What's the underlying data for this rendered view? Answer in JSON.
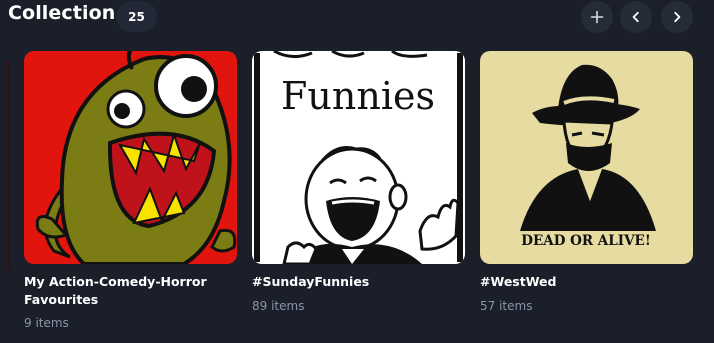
{
  "header": {
    "title": "Collection",
    "count": "25",
    "add_icon": "plus-icon",
    "prev_icon": "chevron-left-icon",
    "next_icon": "chevron-right-icon"
  },
  "collections": [
    {
      "name": "My Action-Comedy-Horror Favourites",
      "count": "9 items",
      "image": "green-cartoon-monster-on-red-background",
      "colors": {
        "background": "#e2140e",
        "monster": "#7b7c13"
      }
    },
    {
      "name": "#SundayFunnies",
      "count": "89 items",
      "image": "laughing-cartoon-man-black-and-white",
      "image_text": "Funnies",
      "colors": {
        "background": "#ffffff"
      }
    },
    {
      "name": "#WestWed",
      "count": "57 items",
      "image": "masked-cowboy-wanted-poster",
      "image_text": "DEAD OR ALIVE!",
      "colors": {
        "background": "#e6dba0"
      }
    }
  ],
  "colors": {
    "page_background": "#1b1f2a",
    "button_background": "#262b38",
    "secondary_text": "#8b93a7"
  }
}
